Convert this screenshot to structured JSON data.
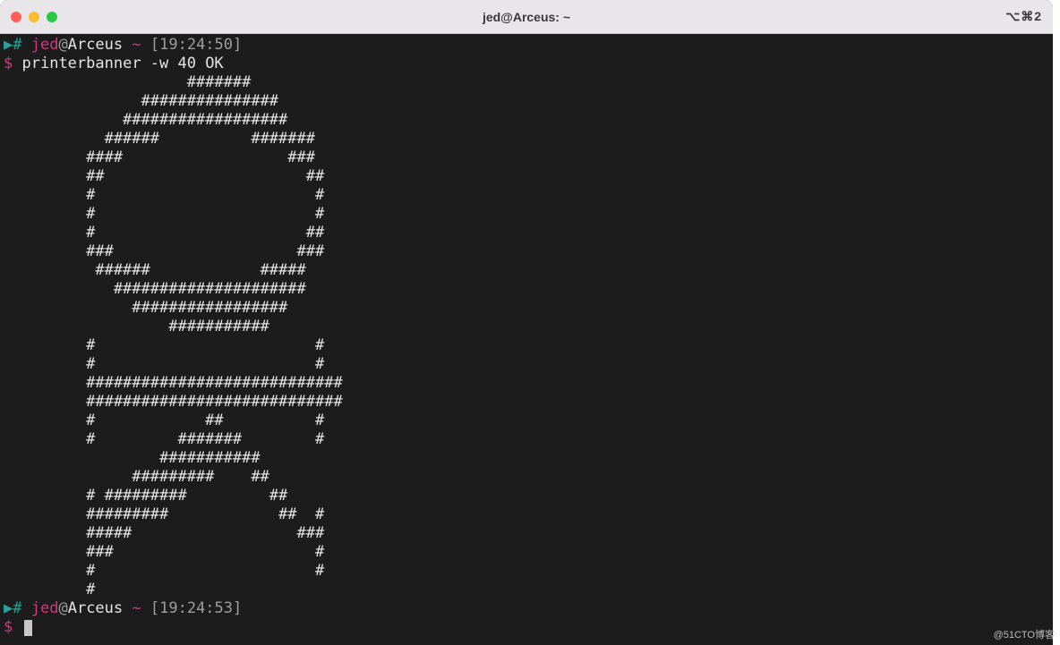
{
  "titlebar": {
    "title": "jed@Arceus: ~",
    "shortcut": "⌥⌘2"
  },
  "prompt1": {
    "arrow": "▶",
    "hash": "#",
    "user": "jed",
    "at": "@",
    "host": "Arceus",
    "tilde": "~",
    "time": "[19:24:50]"
  },
  "command": {
    "dollar": "$",
    "text": "printerbanner -w 40 OK"
  },
  "output": [
    "                    #######",
    "               ###############",
    "             ##################",
    "           ######          #######",
    "         ####                  ###",
    "         ##                      ##",
    "         #                        #",
    "         #                        #",
    "         #                       ##",
    "         ###                    ###",
    "          ######            #####",
    "            #####################",
    "              #################",
    "                  ###########",
    "         #                        #",
    "         #                        #",
    "         ############################",
    "         ############################",
    "         #            ##          #",
    "         #         #######        #",
    "                 ###########",
    "              #########    ##",
    "         # #########         ##",
    "         #########            ##  #",
    "         #####                  ###",
    "         ###                      #",
    "         #                        #",
    "         #"
  ],
  "prompt2": {
    "arrow": "▶",
    "hash": "#",
    "user": "jed",
    "at": "@",
    "host": "Arceus",
    "tilde": "~",
    "time": "[19:24:53]"
  },
  "prompt3": {
    "dollar": "$"
  },
  "watermark": "@51CTO博客"
}
